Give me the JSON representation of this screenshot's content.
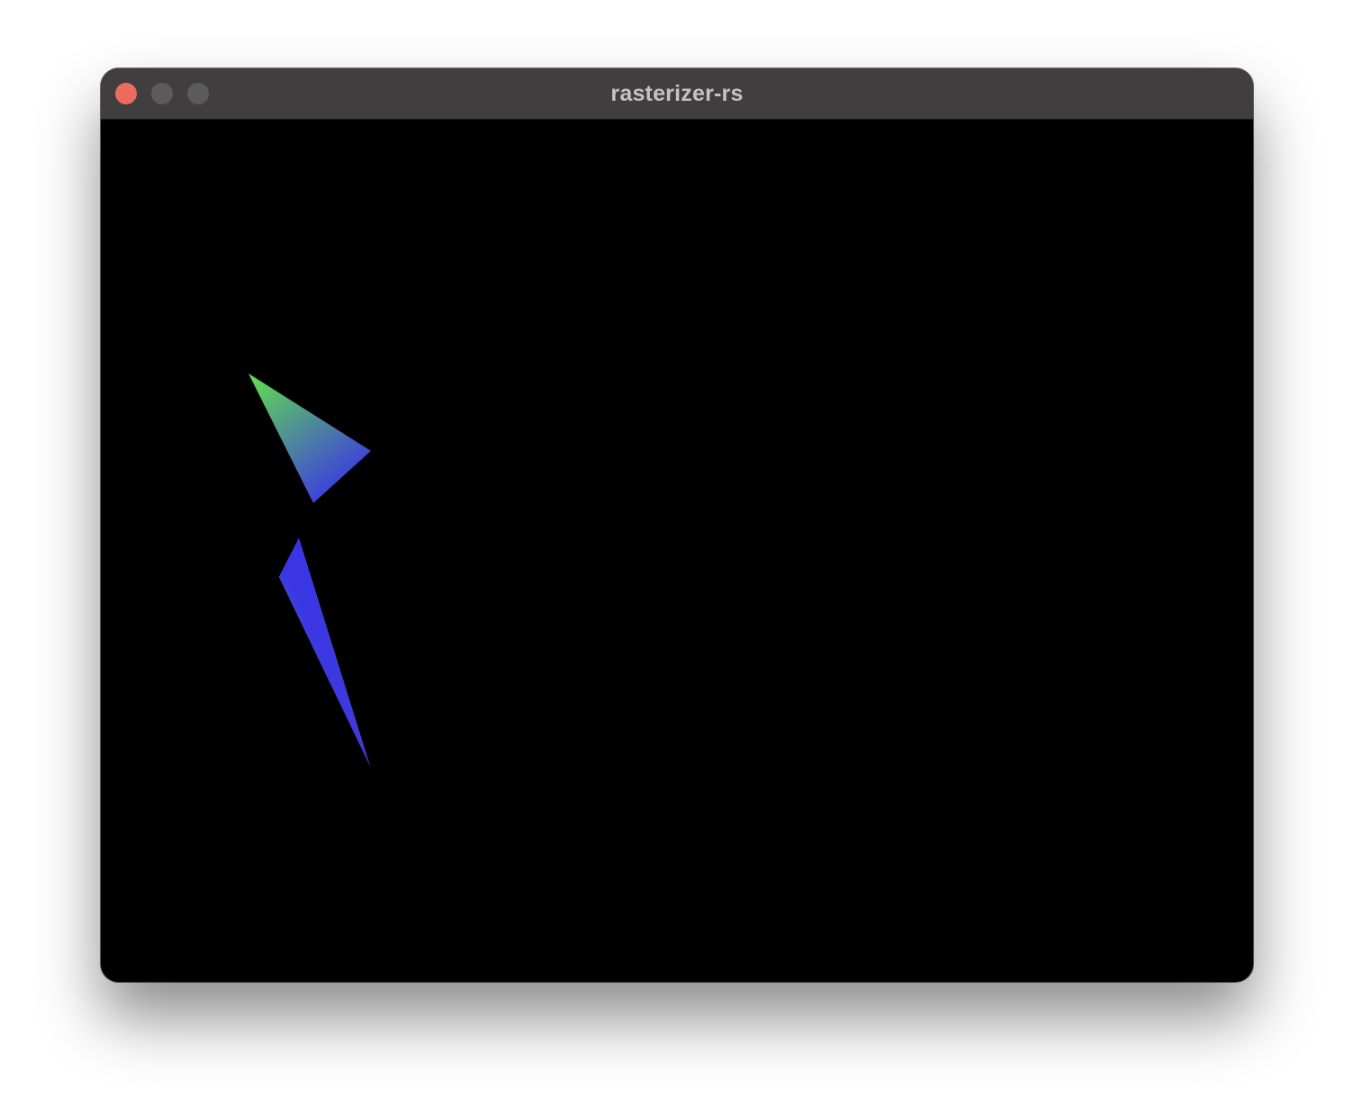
{
  "window": {
    "title": "rasterizer-rs",
    "controls": [
      {
        "name": "close",
        "color": "#ed6a5e"
      },
      {
        "name": "minimize",
        "color": "#5c5b5b"
      },
      {
        "name": "zoom",
        "color": "#5c5b5b"
      }
    ],
    "titlebar_color": "#403e3f",
    "canvas_background": "#000000"
  },
  "scene": {
    "triangle_count": 2,
    "vertex_colors": {
      "green": "#62de4e",
      "blue": "#3a34e6",
      "red": "#e6453a"
    }
  }
}
